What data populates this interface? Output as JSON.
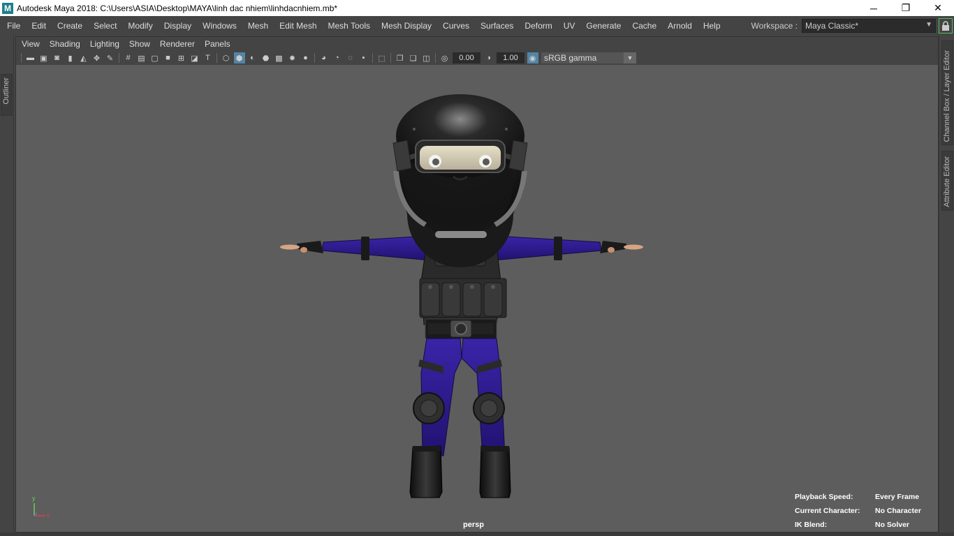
{
  "window": {
    "logo": "M",
    "title": "Autodesk Maya 2018: C:\\Users\\ASIA\\Desktop\\MAYA\\linh dac nhiem\\linhdacnhiem.mb*",
    "minimize": "─",
    "maximize": "❐",
    "close": "✕"
  },
  "menubar": {
    "items": [
      "File",
      "Edit",
      "Create",
      "Select",
      "Modify",
      "Display",
      "Windows",
      "Mesh",
      "Edit Mesh",
      "Mesh Tools",
      "Mesh Display",
      "Curves",
      "Surfaces",
      "Deform",
      "UV",
      "Generate",
      "Cache",
      "Arnold",
      "Help"
    ],
    "workspace_label": "Workspace :",
    "workspace_value": "Maya Classic*"
  },
  "side_tabs": {
    "left": "Outliner",
    "right_top": "Channel Box / Layer Editor",
    "right_bottom": "Attribute Editor"
  },
  "panel": {
    "menu": [
      "View",
      "Shading",
      "Lighting",
      "Show",
      "Renderer",
      "Panels"
    ],
    "exposure": "0.00",
    "gamma": "1.00",
    "color_space": "sRGB gamma",
    "camera": "persp"
  },
  "hud": {
    "playback_speed_label": "Playback Speed:",
    "playback_speed_value": "Every Frame",
    "current_character_label": "Current Character:",
    "current_character_value": "No Character",
    "ik_blend_label": "IK Blend:",
    "ik_blend_value": "No Solver"
  },
  "axis": {
    "y": "y",
    "x": "x"
  },
  "colors": {
    "viewport_bg": "#5d5d5d",
    "ui_bg": "#444444",
    "suit_purple": "#2e1a8c",
    "gear_black": "#1c1c1c",
    "accent_green": "#4fc060"
  }
}
